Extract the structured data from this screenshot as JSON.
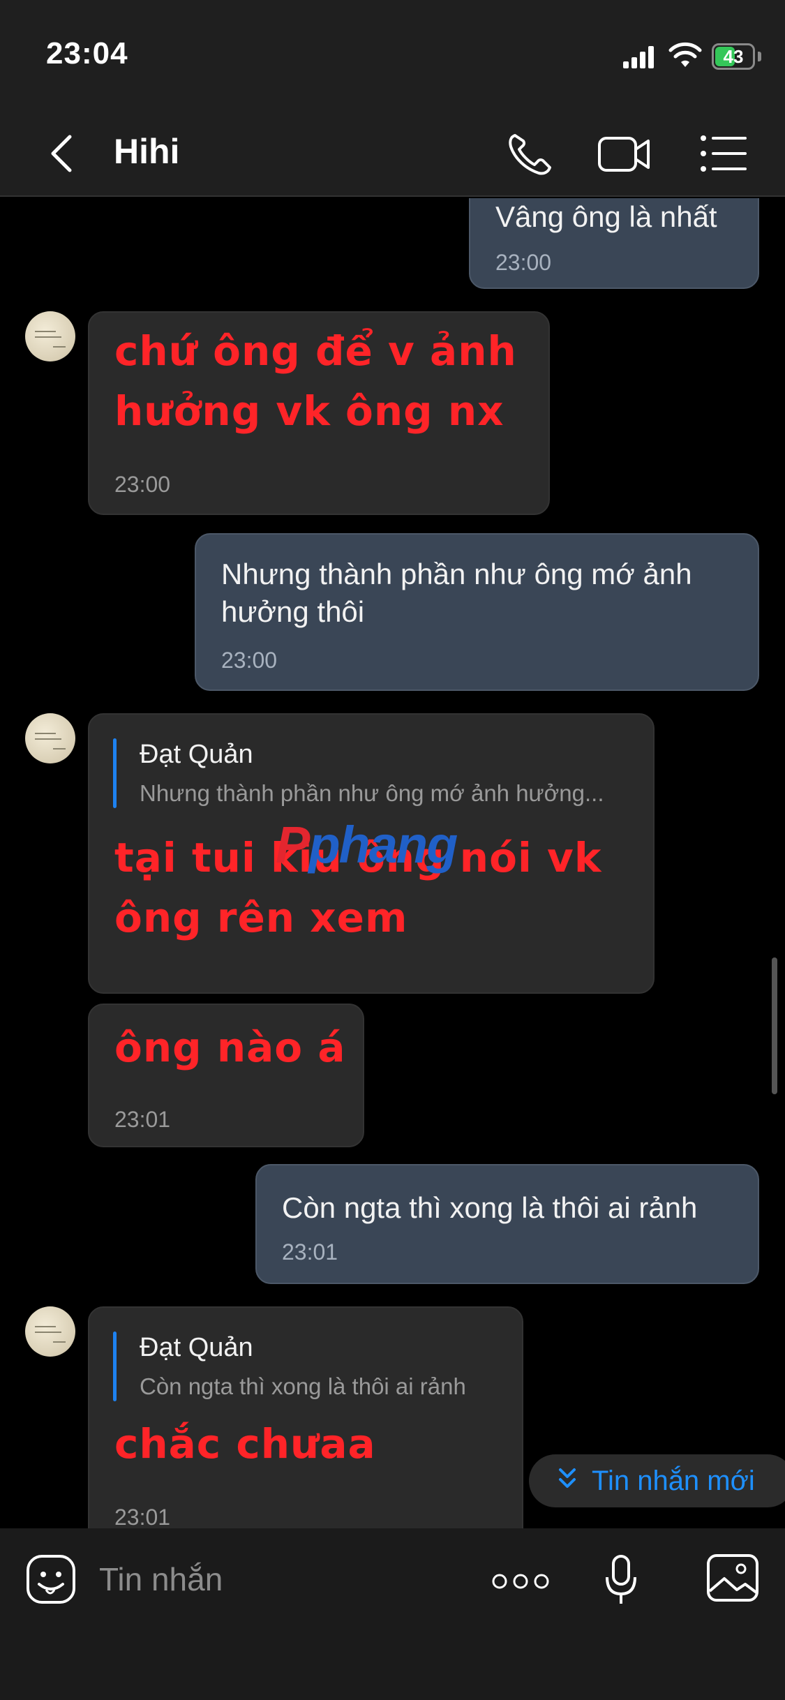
{
  "status": {
    "time": "23:04",
    "battery": "43"
  },
  "header": {
    "title": "Hihi"
  },
  "messages": {
    "m1": {
      "text": "Vâng ông là nhất",
      "time": "23:00"
    },
    "m2": {
      "line1": "chứ ông để v ảnh",
      "line2": "hưởng vk ông nx",
      "time": "23:00"
    },
    "m3": {
      "line1": "Nhưng thành phần như ông mớ ảnh",
      "line2": "hưởng thôi",
      "time": "23:00"
    },
    "m4": {
      "quote_name": "Đạt Quản",
      "quote_text": "Nhưng thành phần như ông mớ ảnh hưởng...",
      "line1": "tại tui kiu ông nói vk",
      "line2": "ông rên xem"
    },
    "m5": {
      "text": "ông nào á",
      "time": "23:01"
    },
    "m6": {
      "text": "Còn ngta thì xong là thôi ai rảnh",
      "time": "23:01"
    },
    "m7": {
      "quote_name": "Đạt Quản",
      "quote_text": "Còn ngta thì xong là thôi ai rảnh",
      "text": "chắc chưaa",
      "time": "23:01"
    }
  },
  "new_message_button": "Tin nhắn mới",
  "watermark": {
    "part1": "P",
    "part2": "phang"
  },
  "input": {
    "placeholder": "Tin nhắn"
  },
  "colors": {
    "accent": "#1e90ff",
    "incoming_bubble": "#2a2a2a",
    "outgoing_bubble": "#3a4656",
    "emphasis_text": "#ff2428"
  }
}
